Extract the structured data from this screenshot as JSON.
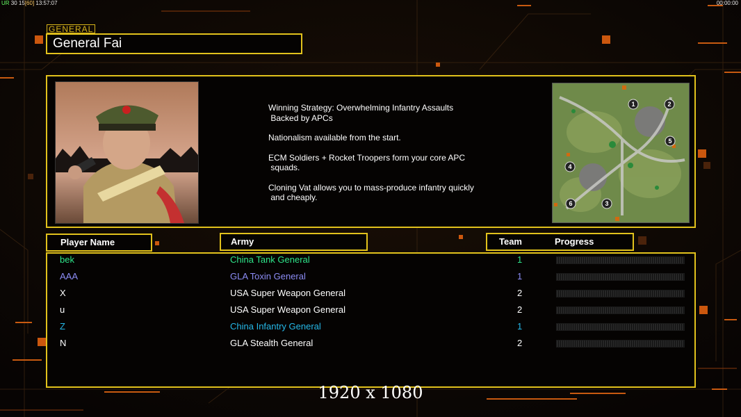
{
  "hud": {
    "fps_prefix": "UR",
    "fps_values": "30 15",
    "fps_bracket": "[60]",
    "time": "13:57:07",
    "clock": "00:00:00"
  },
  "general": {
    "tag": "GENERAL",
    "name": "General Fai"
  },
  "strategy": [
    "Winning Strategy: Overwhelming Infantry Assaults\n Backed by APCs",
    "Nationalism available from the start.",
    "ECM Soldiers + Rocket Troopers form your core APC\n squads.",
    "Cloning Vat allows you to mass-produce infantry quickly\n and cheaply."
  ],
  "minimap": {
    "start_positions": [
      "1",
      "2",
      "3",
      "4",
      "5",
      "6"
    ]
  },
  "columns": {
    "player": "Player Name",
    "army": "Army",
    "team": "Team",
    "progress": "Progress"
  },
  "players": [
    {
      "name": "bek",
      "army": "China Tank General",
      "team": "1",
      "color": "#2ee58a",
      "progress": 0
    },
    {
      "name": "AAA",
      "army": "GLA Toxin General",
      "team": "1",
      "color": "#8c8cf5",
      "progress": 0
    },
    {
      "name": "X",
      "army": "USA Super Weapon General",
      "team": "2",
      "color": "#ffffff",
      "progress": 0
    },
    {
      "name": "u",
      "army": "USA Super Weapon General",
      "team": "2",
      "color": "#ffffff",
      "progress": 0
    },
    {
      "name": "Z",
      "army": "China Infantry General",
      "team": "1",
      "color": "#25b8e8",
      "progress": 0
    },
    {
      "name": "N",
      "army": "GLA Stealth General",
      "team": "2",
      "color": "#ffffff",
      "progress": 0
    }
  ],
  "resolution_label": "1920 x 1080",
  "colors": {
    "accent": "#e2c21c",
    "background": "#0a0604",
    "deco": "#e06010"
  }
}
